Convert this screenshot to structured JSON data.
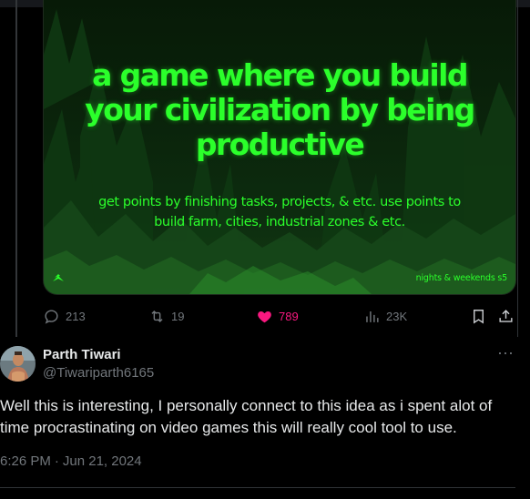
{
  "media": {
    "headline_lines": [
      "a game where you build",
      "your civilization by being",
      "productive"
    ],
    "subline_lines": [
      "get points by finishing tasks, projects, & etc. use points to",
      "build farm, cities, industrial zones & etc."
    ],
    "brand": "nights & weekends s5",
    "accent_color": "#2bff2b"
  },
  "actions": {
    "replies": "213",
    "reposts": "19",
    "likes": "789",
    "views": "23K",
    "like_color": "#f91880"
  },
  "reply": {
    "name": "Parth Tiwari",
    "handle": "@Tiwariparth6165",
    "text": "Well this is interesting, I personally connect to this idea as i spent alot of time procrastinating on video games this will really cool tool to use.",
    "time": "6:26 PM",
    "date": "Jun 21, 2024",
    "more": "···"
  }
}
